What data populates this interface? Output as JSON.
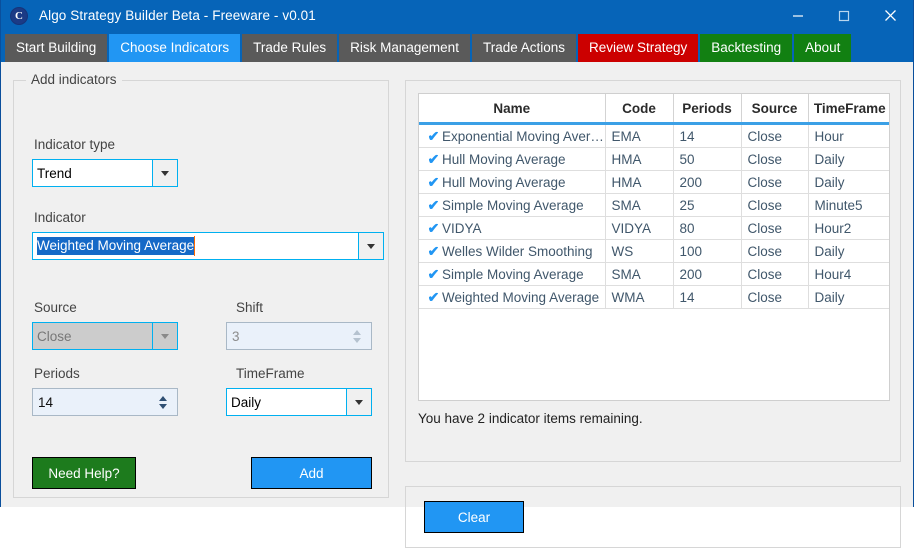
{
  "window": {
    "title": "Algo Strategy Builder Beta - Freeware - v0.01",
    "icon": "C",
    "titlebar_color": "#0664b8",
    "minimize_icon": "minimize-icon",
    "maximize_icon": "maximize-icon",
    "close_icon": "close-icon"
  },
  "tabs": [
    {
      "label": "Start Building",
      "state": "inactive",
      "color": "#5a5a5a"
    },
    {
      "label": "Choose Indicators",
      "state": "active",
      "color": "#2196f3"
    },
    {
      "label": "Trade Rules",
      "state": "inactive",
      "color": "#5a5a5a"
    },
    {
      "label": "Risk Management",
      "state": "inactive",
      "color": "#5a5a5a"
    },
    {
      "label": "Trade Actions",
      "state": "inactive",
      "color": "#5a5a5a"
    },
    {
      "label": "Review Strategy",
      "state": "inactive",
      "color": "#cc0000"
    },
    {
      "label": "Backtesting",
      "state": "inactive",
      "color": "#128012"
    },
    {
      "label": "About",
      "state": "inactive",
      "color": "#128012"
    }
  ],
  "left_panel": {
    "group_title": "Add indicators",
    "indicator_type": {
      "label": "Indicator type",
      "value": "Trend",
      "enabled": true
    },
    "indicator": {
      "label": "Indicator",
      "value": "Weighted Moving Average",
      "selected": true,
      "enabled": true
    },
    "source": {
      "label": "Source",
      "value": "Close",
      "enabled": false
    },
    "shift": {
      "label": "Shift",
      "value": "3",
      "enabled": false
    },
    "periods": {
      "label": "Periods",
      "value": "14",
      "enabled": true
    },
    "timeframe": {
      "label": "TimeFrame",
      "value": "Daily",
      "enabled": true
    },
    "help_button": "Need Help?",
    "add_button": "Add"
  },
  "right_panel": {
    "columns": [
      "Name",
      "Code",
      "Periods",
      "Source",
      "TimeFrame"
    ],
    "rows": [
      {
        "checked": true,
        "name": "Exponential Moving Average",
        "code": "EMA",
        "periods": "14",
        "source": "Close",
        "timeframe": "Hour"
      },
      {
        "checked": true,
        "name": "Hull Moving Average",
        "code": "HMA",
        "periods": "50",
        "source": "Close",
        "timeframe": "Daily"
      },
      {
        "checked": true,
        "name": "Hull Moving Average",
        "code": "HMA",
        "periods": "200",
        "source": "Close",
        "timeframe": "Daily"
      },
      {
        "checked": true,
        "name": "Simple Moving Average",
        "code": "SMA",
        "periods": "25",
        "source": "Close",
        "timeframe": "Minute5"
      },
      {
        "checked": true,
        "name": "VIDYA",
        "code": "VIDYA",
        "periods": "80",
        "source": "Close",
        "timeframe": "Hour2"
      },
      {
        "checked": true,
        "name": "Welles Wilder Smoothing",
        "code": "WS",
        "periods": "100",
        "source": "Close",
        "timeframe": "Daily"
      },
      {
        "checked": true,
        "name": "Simple Moving Average",
        "code": "SMA",
        "periods": "200",
        "source": "Close",
        "timeframe": "Hour4"
      },
      {
        "checked": true,
        "name": "Weighted Moving Average",
        "code": "WMA",
        "periods": "14",
        "source": "Close",
        "timeframe": "Daily"
      }
    ],
    "check_glyph": "✔",
    "status": "You have 2 indicator items remaining.",
    "clear_button": "Clear"
  },
  "colors": {
    "accent_blue": "#2196f3",
    "title_blue": "#0664b8",
    "green": "#1d7b1d",
    "red": "#cc0000",
    "grid_header_underline": "#3ba0e6",
    "selection": "#1569c7"
  }
}
